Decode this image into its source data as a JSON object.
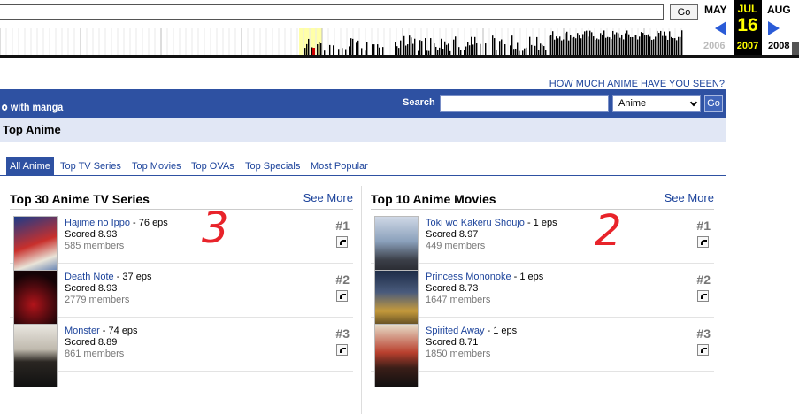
{
  "wayback": {
    "go_label": "Go",
    "months": {
      "prev": "MAY",
      "current": "JUL",
      "next": "AUG"
    },
    "day": "16",
    "years": {
      "prev": "2006",
      "current": "2007",
      "next": "2008"
    }
  },
  "header": {
    "promo_link": "HOW MUCH ANIME HAVE YOU SEEN?",
    "logo_text": "with manga",
    "search_label": "Search",
    "search_value": "",
    "search_type": "Anime",
    "search_go": "Go"
  },
  "page_title": "Top Anime",
  "tabs": [
    "All Anime",
    "Top TV Series",
    "Top Movies",
    "Top OVAs",
    "Top Specials",
    "Most Popular"
  ],
  "left_column": {
    "title": "Top 30 Anime TV Series",
    "see_more": "See More",
    "entries": [
      {
        "name": "Hajime no Ippo",
        "eps": " - 76 eps",
        "score": "Scored 8.93",
        "members": "585 members",
        "rank": "#1"
      },
      {
        "name": "Death Note",
        "eps": " - 37 eps",
        "score": "Scored 8.93",
        "members": "2779 members",
        "rank": "#2"
      },
      {
        "name": "Monster",
        "eps": " - 74 eps",
        "score": "Scored 8.89",
        "members": "861 members",
        "rank": "#3"
      }
    ]
  },
  "right_column": {
    "title": "Top 10 Anime Movies",
    "see_more": "See More",
    "entries": [
      {
        "name": "Toki wo Kakeru Shoujo",
        "eps": " - 1 eps",
        "score": "Scored 8.97",
        "members": "449 members",
        "rank": "#1"
      },
      {
        "name": "Princess Mononoke",
        "eps": " - 1 eps",
        "score": "Scored 8.73",
        "members": "1647 members",
        "rank": "#2"
      },
      {
        "name": "Spirited Away",
        "eps": " - 1 eps",
        "score": "Scored 8.71",
        "members": "1850 members",
        "rank": "#3"
      }
    ]
  },
  "annotations": {
    "left": "3",
    "right": "2"
  }
}
